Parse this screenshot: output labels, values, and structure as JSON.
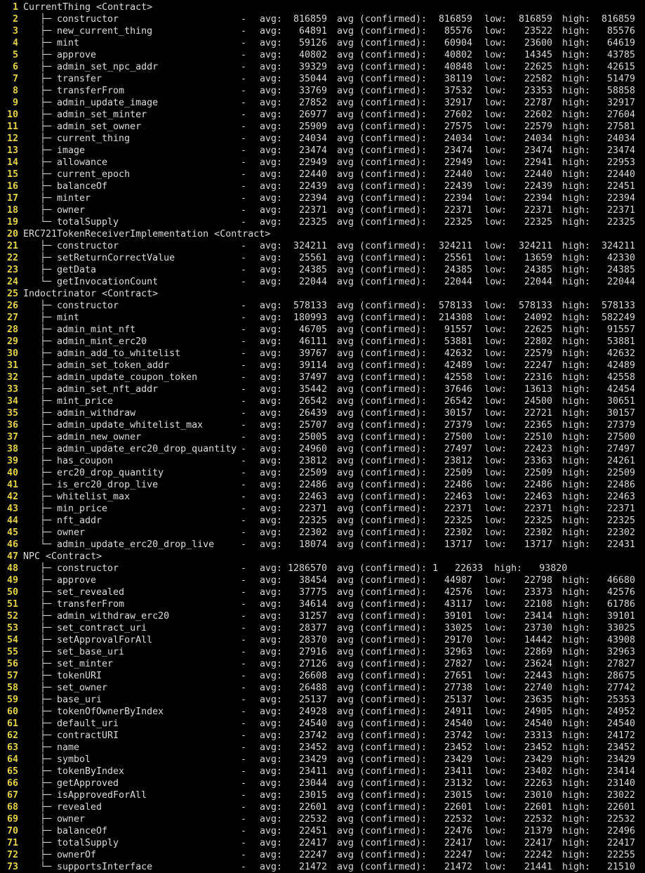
{
  "colors": {
    "background": "#000000",
    "text": "#d8d8d8",
    "line_number": "#e6d246"
  },
  "labels": {
    "dash": "-",
    "avg": "avg:",
    "avg_confirmed": "avg (confirmed):",
    "low": "low:",
    "high": "high:",
    "branch": "├─",
    "last_branch": "└─"
  },
  "lines": [
    {
      "n": "1",
      "type": "contract",
      "text": "CurrentThing <Contract>"
    },
    {
      "n": "2",
      "type": "fn",
      "name": "constructor",
      "avg": "816859",
      "conf": "816859",
      "low": "816859",
      "high": "816859"
    },
    {
      "n": "3",
      "type": "fn",
      "name": "new_current_thing",
      "avg": "64891",
      "conf": "85576",
      "low": "23522",
      "high": "85576"
    },
    {
      "n": "4",
      "type": "fn",
      "name": "mint",
      "avg": "59126",
      "conf": "60904",
      "low": "23600",
      "high": "64619"
    },
    {
      "n": "5",
      "type": "fn",
      "name": "approve",
      "avg": "40802",
      "conf": "40802",
      "low": "14345",
      "high": "43785"
    },
    {
      "n": "6",
      "type": "fn",
      "name": "admin_set_npc_addr",
      "avg": "39329",
      "conf": "40848",
      "low": "22625",
      "high": "42615"
    },
    {
      "n": "7",
      "type": "fn",
      "name": "transfer",
      "avg": "35044",
      "conf": "38119",
      "low": "22582",
      "high": "51479"
    },
    {
      "n": "8",
      "type": "fn",
      "name": "transferFrom",
      "avg": "33769",
      "conf": "37532",
      "low": "23353",
      "high": "58858"
    },
    {
      "n": "9",
      "type": "fn",
      "name": "admin_update_image",
      "avg": "27852",
      "conf": "32917",
      "low": "22787",
      "high": "32917"
    },
    {
      "n": "10",
      "type": "fn",
      "name": "admin_set_minter",
      "avg": "26977",
      "conf": "27602",
      "low": "22602",
      "high": "27604"
    },
    {
      "n": "11",
      "type": "fn",
      "name": "admin_set_owner",
      "avg": "25909",
      "conf": "27575",
      "low": "22579",
      "high": "27581"
    },
    {
      "n": "12",
      "type": "fn",
      "name": "current_thing",
      "avg": "24034",
      "conf": "24034",
      "low": "24034",
      "high": "24034"
    },
    {
      "n": "13",
      "type": "fn",
      "name": "image",
      "avg": "23474",
      "conf": "23474",
      "low": "23474",
      "high": "23474"
    },
    {
      "n": "14",
      "type": "fn",
      "name": "allowance",
      "avg": "22949",
      "conf": "22949",
      "low": "22941",
      "high": "22953"
    },
    {
      "n": "15",
      "type": "fn",
      "name": "current_epoch",
      "avg": "22440",
      "conf": "22440",
      "low": "22440",
      "high": "22440"
    },
    {
      "n": "16",
      "type": "fn",
      "name": "balanceOf",
      "avg": "22439",
      "conf": "22439",
      "low": "22439",
      "high": "22451"
    },
    {
      "n": "17",
      "type": "fn",
      "name": "minter",
      "avg": "22394",
      "conf": "22394",
      "low": "22394",
      "high": "22394"
    },
    {
      "n": "18",
      "type": "fn",
      "name": "owner",
      "avg": "22371",
      "conf": "22371",
      "low": "22371",
      "high": "22371"
    },
    {
      "n": "19",
      "type": "fn",
      "last": true,
      "name": "totalSupply",
      "avg": "22325",
      "conf": "22325",
      "low": "22325",
      "high": "22325"
    },
    {
      "n": "20",
      "type": "contract",
      "text": "ERC721TokenReceiverImplementation <Contract>"
    },
    {
      "n": "21",
      "type": "fn",
      "name": "constructor",
      "avg": "324211",
      "conf": "324211",
      "low": "324211",
      "high": "324211"
    },
    {
      "n": "22",
      "type": "fn",
      "name": "setReturnCorrectValue",
      "avg": "25561",
      "conf": "25561",
      "low": "13659",
      "high": "42330"
    },
    {
      "n": "23",
      "type": "fn",
      "name": "getData",
      "avg": "24385",
      "conf": "24385",
      "low": "24385",
      "high": "24385"
    },
    {
      "n": "24",
      "type": "fn",
      "last": true,
      "name": "getInvocationCount",
      "avg": "22044",
      "conf": "22044",
      "low": "22044",
      "high": "22044"
    },
    {
      "n": "25",
      "type": "contract",
      "text": "Indoctrinator <Contract>"
    },
    {
      "n": "26",
      "type": "fn",
      "name": "constructor",
      "avg": "578133",
      "conf": "578133",
      "low": "578133",
      "high": "578133"
    },
    {
      "n": "27",
      "type": "fn",
      "name": "mint",
      "avg": "180993",
      "conf": "214308",
      "low": "24092",
      "high": "582249"
    },
    {
      "n": "28",
      "type": "fn",
      "name": "admin_mint_nft",
      "avg": "46705",
      "conf": "91557",
      "low": "22625",
      "high": "91557"
    },
    {
      "n": "29",
      "type": "fn",
      "name": "admin_mint_erc20",
      "avg": "46111",
      "conf": "53881",
      "low": "22802",
      "high": "53881"
    },
    {
      "n": "30",
      "type": "fn",
      "name": "admin_add_to_whitelist",
      "avg": "39767",
      "conf": "42632",
      "low": "22579",
      "high": "42632"
    },
    {
      "n": "31",
      "type": "fn",
      "name": "admin_set_token_addr",
      "avg": "39114",
      "conf": "42489",
      "low": "22247",
      "high": "42489"
    },
    {
      "n": "32",
      "type": "fn",
      "name": "admin_update_coupon_token",
      "avg": "37497",
      "conf": "42558",
      "low": "22316",
      "high": "42558"
    },
    {
      "n": "33",
      "type": "fn",
      "name": "admin_set_nft_addr",
      "avg": "35442",
      "conf": "37646",
      "low": "13613",
      "high": "42454"
    },
    {
      "n": "34",
      "type": "fn",
      "name": "mint_price",
      "avg": "26542",
      "conf": "26542",
      "low": "24500",
      "high": "30651"
    },
    {
      "n": "35",
      "type": "fn",
      "name": "admin_withdraw",
      "avg": "26439",
      "conf": "30157",
      "low": "22721",
      "high": "30157"
    },
    {
      "n": "36",
      "type": "fn",
      "name": "admin_update_whitelist_max",
      "avg": "25707",
      "conf": "27379",
      "low": "22365",
      "high": "27379"
    },
    {
      "n": "37",
      "type": "fn",
      "name": "admin_new_owner",
      "avg": "25005",
      "conf": "27500",
      "low": "22510",
      "high": "27500"
    },
    {
      "n": "38",
      "type": "fn",
      "name": "admin_update_erc20_drop_quantity",
      "avg": "24960",
      "conf": "27497",
      "low": "22423",
      "high": "27497"
    },
    {
      "n": "39",
      "type": "fn",
      "name": "has_coupon",
      "avg": "23812",
      "conf": "23812",
      "low": "23363",
      "high": "24261"
    },
    {
      "n": "40",
      "type": "fn",
      "name": "erc20_drop_quantity",
      "avg": "22509",
      "conf": "22509",
      "low": "22509",
      "high": "22509"
    },
    {
      "n": "41",
      "type": "fn",
      "name": "is_erc20_drop_live",
      "avg": "22486",
      "conf": "22486",
      "low": "22486",
      "high": "22486"
    },
    {
      "n": "42",
      "type": "fn",
      "name": "whitelist_max",
      "avg": "22463",
      "conf": "22463",
      "low": "22463",
      "high": "22463"
    },
    {
      "n": "43",
      "type": "fn",
      "name": "min_price",
      "avg": "22371",
      "conf": "22371",
      "low": "22371",
      "high": "22371"
    },
    {
      "n": "44",
      "type": "fn",
      "name": "nft_addr",
      "avg": "22325",
      "conf": "22325",
      "low": "22325",
      "high": "22325"
    },
    {
      "n": "45",
      "type": "fn",
      "name": "owner",
      "avg": "22302",
      "conf": "22302",
      "low": "22302",
      "high": "22302"
    },
    {
      "n": "46",
      "type": "fn",
      "last": true,
      "name": "admin_update_erc20_drop_live",
      "avg": "18074",
      "conf": "13717",
      "low": "13717",
      "high": "22431"
    },
    {
      "n": "47",
      "type": "contract",
      "text": "NPC <Contract>"
    },
    {
      "n": "48",
      "type": "fn",
      "name": "constructor",
      "avg": "1286570",
      "raw": "avg (confirmed): 1   22633  high:   93820"
    },
    {
      "n": "49",
      "type": "fn",
      "name": "approve",
      "avg": "38454",
      "conf": "44987",
      "low": "22798",
      "high": "46680"
    },
    {
      "n": "50",
      "type": "fn",
      "name": "set_revealed",
      "avg": "37775",
      "conf": "42576",
      "low": "23373",
      "high": "42576"
    },
    {
      "n": "51",
      "type": "fn",
      "name": "transferFrom",
      "avg": "34614",
      "conf": "43117",
      "low": "22108",
      "high": "61786"
    },
    {
      "n": "52",
      "type": "fn",
      "name": "admin_withdraw_erc20",
      "avg": "31257",
      "conf": "39101",
      "low": "23414",
      "high": "39101"
    },
    {
      "n": "53",
      "type": "fn",
      "name": "set_contract_uri",
      "avg": "28377",
      "conf": "33025",
      "low": "23730",
      "high": "33025"
    },
    {
      "n": "54",
      "type": "fn",
      "name": "setApprovalForAll",
      "avg": "28370",
      "conf": "29170",
      "low": "14442",
      "high": "43908"
    },
    {
      "n": "55",
      "type": "fn",
      "name": "set_base_uri",
      "avg": "27916",
      "conf": "32963",
      "low": "22869",
      "high": "32963"
    },
    {
      "n": "56",
      "type": "fn",
      "name": "set_minter",
      "avg": "27126",
      "conf": "27827",
      "low": "23624",
      "high": "27827"
    },
    {
      "n": "57",
      "type": "fn",
      "name": "tokenURI",
      "avg": "26608",
      "conf": "27651",
      "low": "22443",
      "high": "28675"
    },
    {
      "n": "58",
      "type": "fn",
      "name": "set_owner",
      "avg": "26488",
      "conf": "27738",
      "low": "22740",
      "high": "27742"
    },
    {
      "n": "59",
      "type": "fn",
      "name": "base_uri",
      "avg": "25137",
      "conf": "25137",
      "low": "23635",
      "high": "25353"
    },
    {
      "n": "60",
      "type": "fn",
      "name": "tokenOfOwnerByIndex",
      "avg": "24928",
      "conf": "24911",
      "low": "24905",
      "high": "24952"
    },
    {
      "n": "61",
      "type": "fn",
      "name": "default_uri",
      "avg": "24540",
      "conf": "24540",
      "low": "24540",
      "high": "24540"
    },
    {
      "n": "62",
      "type": "fn",
      "name": "contractURI",
      "avg": "23742",
      "conf": "23742",
      "low": "23313",
      "high": "24172"
    },
    {
      "n": "63",
      "type": "fn",
      "name": "name",
      "avg": "23452",
      "conf": "23452",
      "low": "23452",
      "high": "23452"
    },
    {
      "n": "64",
      "type": "fn",
      "name": "symbol",
      "avg": "23429",
      "conf": "23429",
      "low": "23429",
      "high": "23429"
    },
    {
      "n": "65",
      "type": "fn",
      "name": "tokenByIndex",
      "avg": "23411",
      "conf": "23411",
      "low": "23402",
      "high": "23414"
    },
    {
      "n": "66",
      "type": "fn",
      "name": "getApproved",
      "avg": "23044",
      "conf": "23132",
      "low": "22263",
      "high": "23140"
    },
    {
      "n": "67",
      "type": "fn",
      "name": "isApprovedForAll",
      "avg": "23015",
      "conf": "23015",
      "low": "23010",
      "high": "23022"
    },
    {
      "n": "68",
      "type": "fn",
      "name": "revealed",
      "avg": "22601",
      "conf": "22601",
      "low": "22601",
      "high": "22601"
    },
    {
      "n": "69",
      "type": "fn",
      "name": "owner",
      "avg": "22532",
      "conf": "22532",
      "low": "22532",
      "high": "22532"
    },
    {
      "n": "70",
      "type": "fn",
      "name": "balanceOf",
      "avg": "22451",
      "conf": "22476",
      "low": "21379",
      "high": "22496"
    },
    {
      "n": "71",
      "type": "fn",
      "name": "totalSupply",
      "avg": "22417",
      "conf": "22417",
      "low": "22417",
      "high": "22417"
    },
    {
      "n": "72",
      "type": "fn",
      "name": "ownerOf",
      "avg": "22247",
      "conf": "22247",
      "low": "22242",
      "high": "22255"
    },
    {
      "n": "73",
      "type": "fn",
      "last": true,
      "name": "supportsInterface",
      "avg": "21472",
      "conf": "21472",
      "low": "21441",
      "high": "21510"
    }
  ]
}
